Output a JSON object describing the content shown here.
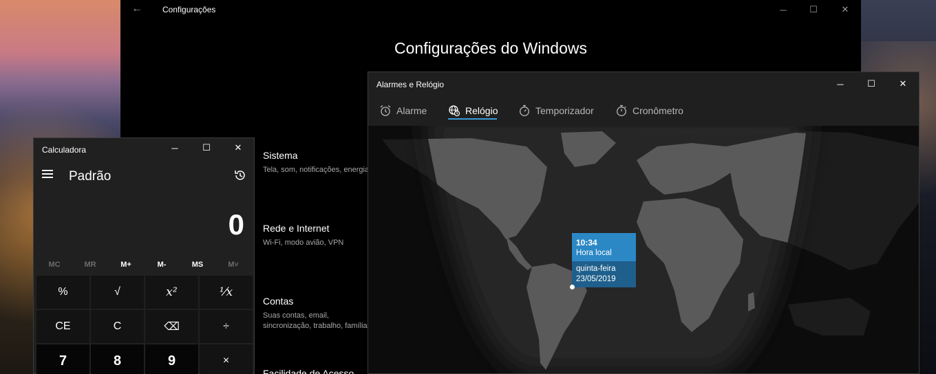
{
  "settings": {
    "title": "Configurações",
    "heading": "Configurações do Windows",
    "categories": [
      {
        "title": "Sistema",
        "desc": "Tela, som, notificações, energia"
      },
      {
        "title": "Rede e Internet",
        "desc": "Wi-Fi, modo avião, VPN"
      },
      {
        "title": "Contas",
        "desc": "Suas contas, email,\nsincronização, trabalho, família"
      },
      {
        "title": "Facilidade de Acesso",
        "desc": ""
      }
    ]
  },
  "calculator": {
    "title": "Calculadora",
    "mode": "Padrão",
    "display": "0",
    "memory": [
      "MC",
      "MR",
      "M+",
      "M-",
      "MS",
      "M˅"
    ],
    "keys": [
      [
        "%",
        "√",
        "x²",
        "¹⁄x"
      ],
      [
        "CE",
        "C",
        "⌫",
        "÷"
      ],
      [
        "7",
        "8",
        "9",
        "×"
      ]
    ]
  },
  "alarms": {
    "title": "Alarmes e Relógio",
    "tabs": [
      "Alarme",
      "Relógio",
      "Temporizador",
      "Cronômetro"
    ],
    "active_tab": "Relógio",
    "local_time": {
      "time": "10:34",
      "label": "Hora local",
      "day": "quinta-feira",
      "date": "23/05/2019"
    }
  },
  "colors": {
    "accent": "#2b88c5",
    "accent_dark": "#1f5f8c",
    "tab_underline": "#3b9bd8",
    "land_day": "#5a5a5a",
    "night": "#0c0c0c"
  }
}
